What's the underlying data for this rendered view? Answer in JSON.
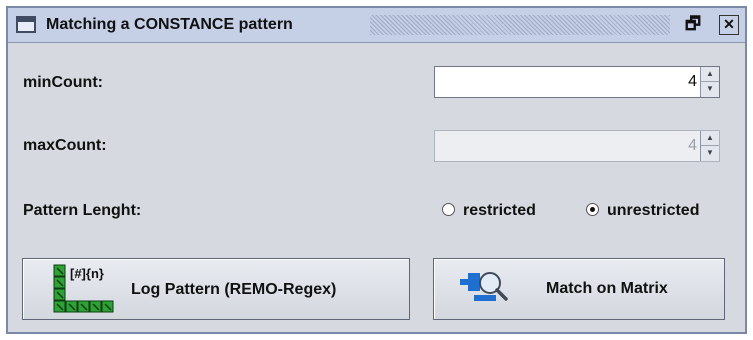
{
  "window": {
    "title": "Matching a CONSTANCE pattern",
    "maximize_icon": "maximize-icon",
    "close_icon": "close-icon"
  },
  "fields": [
    {
      "label": "minCount:",
      "value": "4",
      "enabled": true
    },
    {
      "label": "maxCount:",
      "value": "4",
      "enabled": false
    }
  ],
  "pattern_length": {
    "label": "Pattern Lenght:",
    "options": [
      {
        "label": "restricted",
        "selected": false
      },
      {
        "label": "unrestricted",
        "selected": true
      }
    ]
  },
  "buttons": {
    "log_pattern": {
      "icon_text": "[#]{n}",
      "label": "Log Pattern (REMO-Regex)",
      "icon": "grid-pattern-icon"
    },
    "match_matrix": {
      "label": "Match on Matrix",
      "icon": "matrix-search-icon"
    }
  },
  "colors": {
    "title_bar": "#c5cfe6",
    "panel": "#d6d9df",
    "grid_icon_green": "#2fa236",
    "matrix_icon_blue": "#1f6fd0"
  }
}
